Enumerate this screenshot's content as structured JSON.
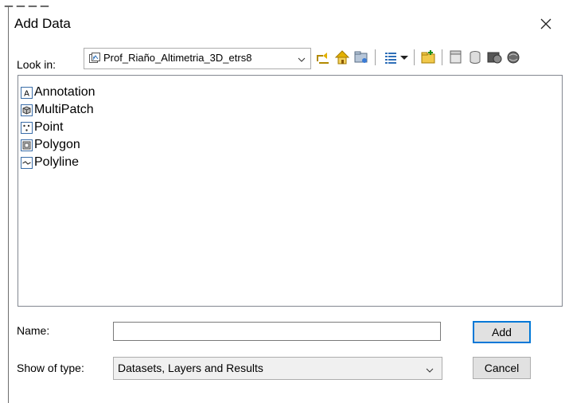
{
  "window": {
    "title": "Add Data",
    "close_icon": "close-icon"
  },
  "lookin": {
    "label": "Look in:",
    "value": "Prof_Riaño_Altimetria_3D_etrs8",
    "icon": "feature-dataset-icon"
  },
  "toolbar": {
    "icons": [
      "up-one-level-icon",
      "home-icon",
      "connect-folder-icon",
      "view-list-icon",
      "view-dropdown-icon",
      "new-folder-icon",
      "catalog-icon",
      "database-icon",
      "globe-icon",
      "toolbox-icon"
    ]
  },
  "items": [
    {
      "label": "Annotation",
      "icon": "annotation-icon"
    },
    {
      "label": "MultiPatch",
      "icon": "multipatch-icon"
    },
    {
      "label": "Point",
      "icon": "point-icon"
    },
    {
      "label": "Polygon",
      "icon": "polygon-icon"
    },
    {
      "label": "Polyline",
      "icon": "polyline-icon"
    }
  ],
  "form": {
    "name_label": "Name:",
    "name_value": "",
    "type_label": "Show of type:",
    "type_value": "Datasets, Layers and Results"
  },
  "buttons": {
    "add": "Add",
    "cancel": "Cancel"
  },
  "colors": {
    "accent": "#0078d7",
    "button_bg": "#e1e1e1",
    "border": "#adadad"
  }
}
